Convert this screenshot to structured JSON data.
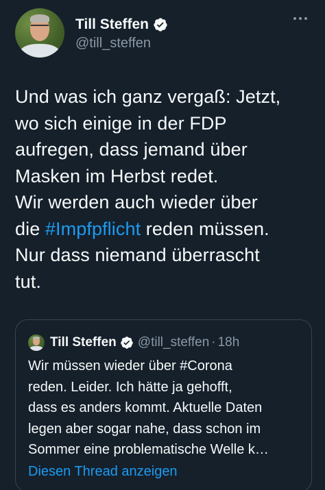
{
  "tweet": {
    "author": {
      "display_name": "Till Steffen",
      "handle": "@till_steffen",
      "avatar_icon": "profile-photo",
      "verified_icon": "verified-badge-icon"
    },
    "more_icon": "more-options-icon",
    "text_lines": [
      {
        "parts": [
          {
            "text": "Und was ich ganz vergaß: Jetzt,"
          }
        ]
      },
      {
        "parts": [
          {
            "text": "wo sich einige in der FDP"
          }
        ]
      },
      {
        "parts": [
          {
            "text": "aufregen, dass jemand über"
          }
        ]
      },
      {
        "parts": [
          {
            "text": "Masken im Herbst redet."
          }
        ]
      },
      {
        "parts": [
          {
            "text": "Wir werden auch wieder über"
          }
        ]
      },
      {
        "parts": [
          {
            "text": "die "
          },
          {
            "text": "#Impfpflicht",
            "hashtag": true
          },
          {
            "text": " reden müssen."
          }
        ]
      },
      {
        "parts": [
          {
            "text": "Nur dass niemand überrascht"
          }
        ]
      },
      {
        "parts": [
          {
            "text": "tut."
          }
        ]
      }
    ]
  },
  "quoted_tweet": {
    "display_name": "Till Steffen",
    "handle": "@till_steffen",
    "separator": "·",
    "time": "18h",
    "text_lines": [
      "Wir müssen wieder über #Corona",
      "reden. Leider. Ich hätte ja gehofft,",
      "dass es anders kommt. Aktuelle Daten",
      "legen aber sogar nahe, dass schon im",
      "Sommer eine problematische Welle k…"
    ],
    "show_thread_label": "Diesen Thread anzeigen"
  },
  "colors": {
    "background": "#15202b",
    "text": "#f7f9f9",
    "secondary": "#8b98a5",
    "accent": "#1d9bf0",
    "border": "#38444d"
  }
}
